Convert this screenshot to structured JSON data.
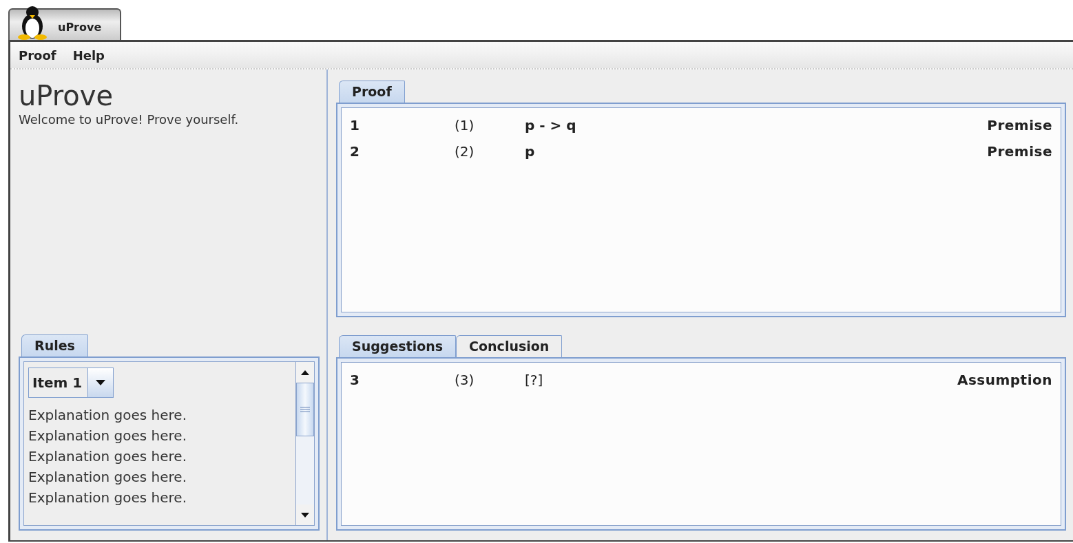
{
  "window": {
    "title": "uProve"
  },
  "menu": [
    {
      "label": "Proof"
    },
    {
      "label": "Help"
    }
  ],
  "intro": {
    "title": "uProve",
    "text": "Welcome to uProve! Prove yourself."
  },
  "rules": {
    "tabs": [
      {
        "label": "Rules",
        "selected": true
      }
    ],
    "dropdown": {
      "value": "Item 1"
    },
    "lines": [
      "Explanation goes here.",
      "Explanation goes here.",
      "Explanation goes here.",
      "Explanation goes here.",
      "Explanation goes here."
    ]
  },
  "proof": {
    "tabs": [
      {
        "label": "Proof",
        "selected": true
      }
    ],
    "rows": [
      {
        "line": "1",
        "ref": "(1)",
        "formula": "p - > q",
        "rule": "Premise"
      },
      {
        "line": "2",
        "ref": "(2)",
        "formula": "p",
        "rule": "Premise"
      }
    ]
  },
  "suggestions": {
    "tabs": [
      {
        "label": "Suggestions",
        "selected": true
      },
      {
        "label": "Conclusion",
        "selected": false
      }
    ],
    "rows": [
      {
        "line": "3",
        "ref": "(3)",
        "formula": "[?]",
        "rule": "Assumption"
      }
    ]
  }
}
